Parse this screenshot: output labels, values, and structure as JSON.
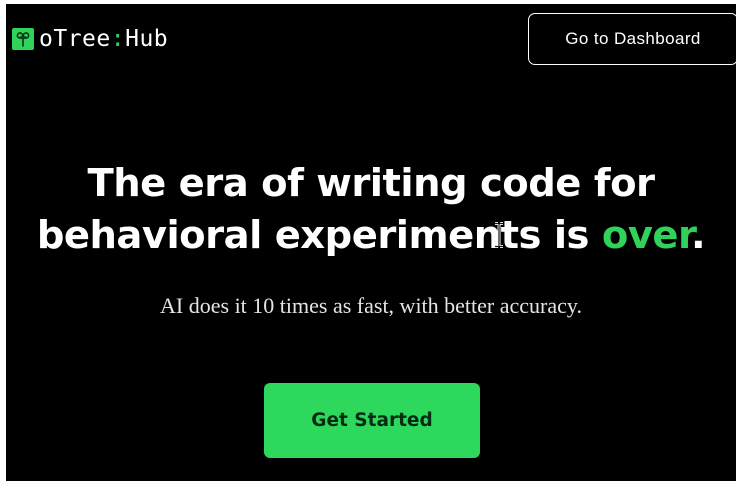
{
  "brand": {
    "name_part1": "oTree",
    "separator": ":",
    "name_part2": "Hub",
    "accent_color": "#2fd35a",
    "icon": "sprout-icon"
  },
  "nav": {
    "dashboard_label": "Go to Dashboard"
  },
  "hero": {
    "headline_line1": "The era of writing code for",
    "headline_line2_prefix": "behavioral experiments is ",
    "headline_accent": "over",
    "headline_end": ".",
    "subtitle": "AI does it 10 times as fast, with better accuracy.",
    "cta_label": "Get Started",
    "cta_color": "#2ed85c"
  },
  "cursor": "text-cursor-icon"
}
